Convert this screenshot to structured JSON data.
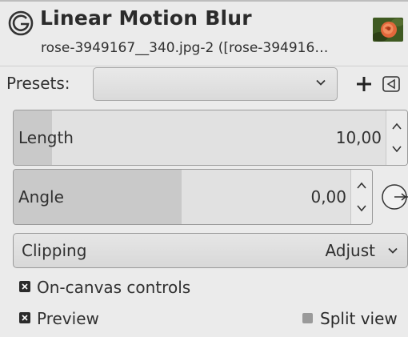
{
  "header": {
    "title": "Linear Motion Blur",
    "subtitle": "rose-3949167__340.jpg-2 ([rose-394916…",
    "icon": "gimp-icon",
    "thumbnail": "rose-thumbnail"
  },
  "presets": {
    "label": "Presets:",
    "value": "",
    "add_icon": "plus-icon",
    "menu_icon": "triangle-left-icon"
  },
  "length": {
    "label": "Length",
    "value": "10,00"
  },
  "angle": {
    "label": "Angle",
    "value": "0,00",
    "dial_icon": "angle-dial-icon"
  },
  "clipping": {
    "label": "Clipping",
    "value": "Adjust"
  },
  "options": {
    "on_canvas_controls": {
      "label": "On-canvas controls",
      "checked": true
    },
    "preview": {
      "label": "Preview",
      "checked": true
    },
    "split_view": {
      "label": "Split view",
      "checked": false
    }
  }
}
